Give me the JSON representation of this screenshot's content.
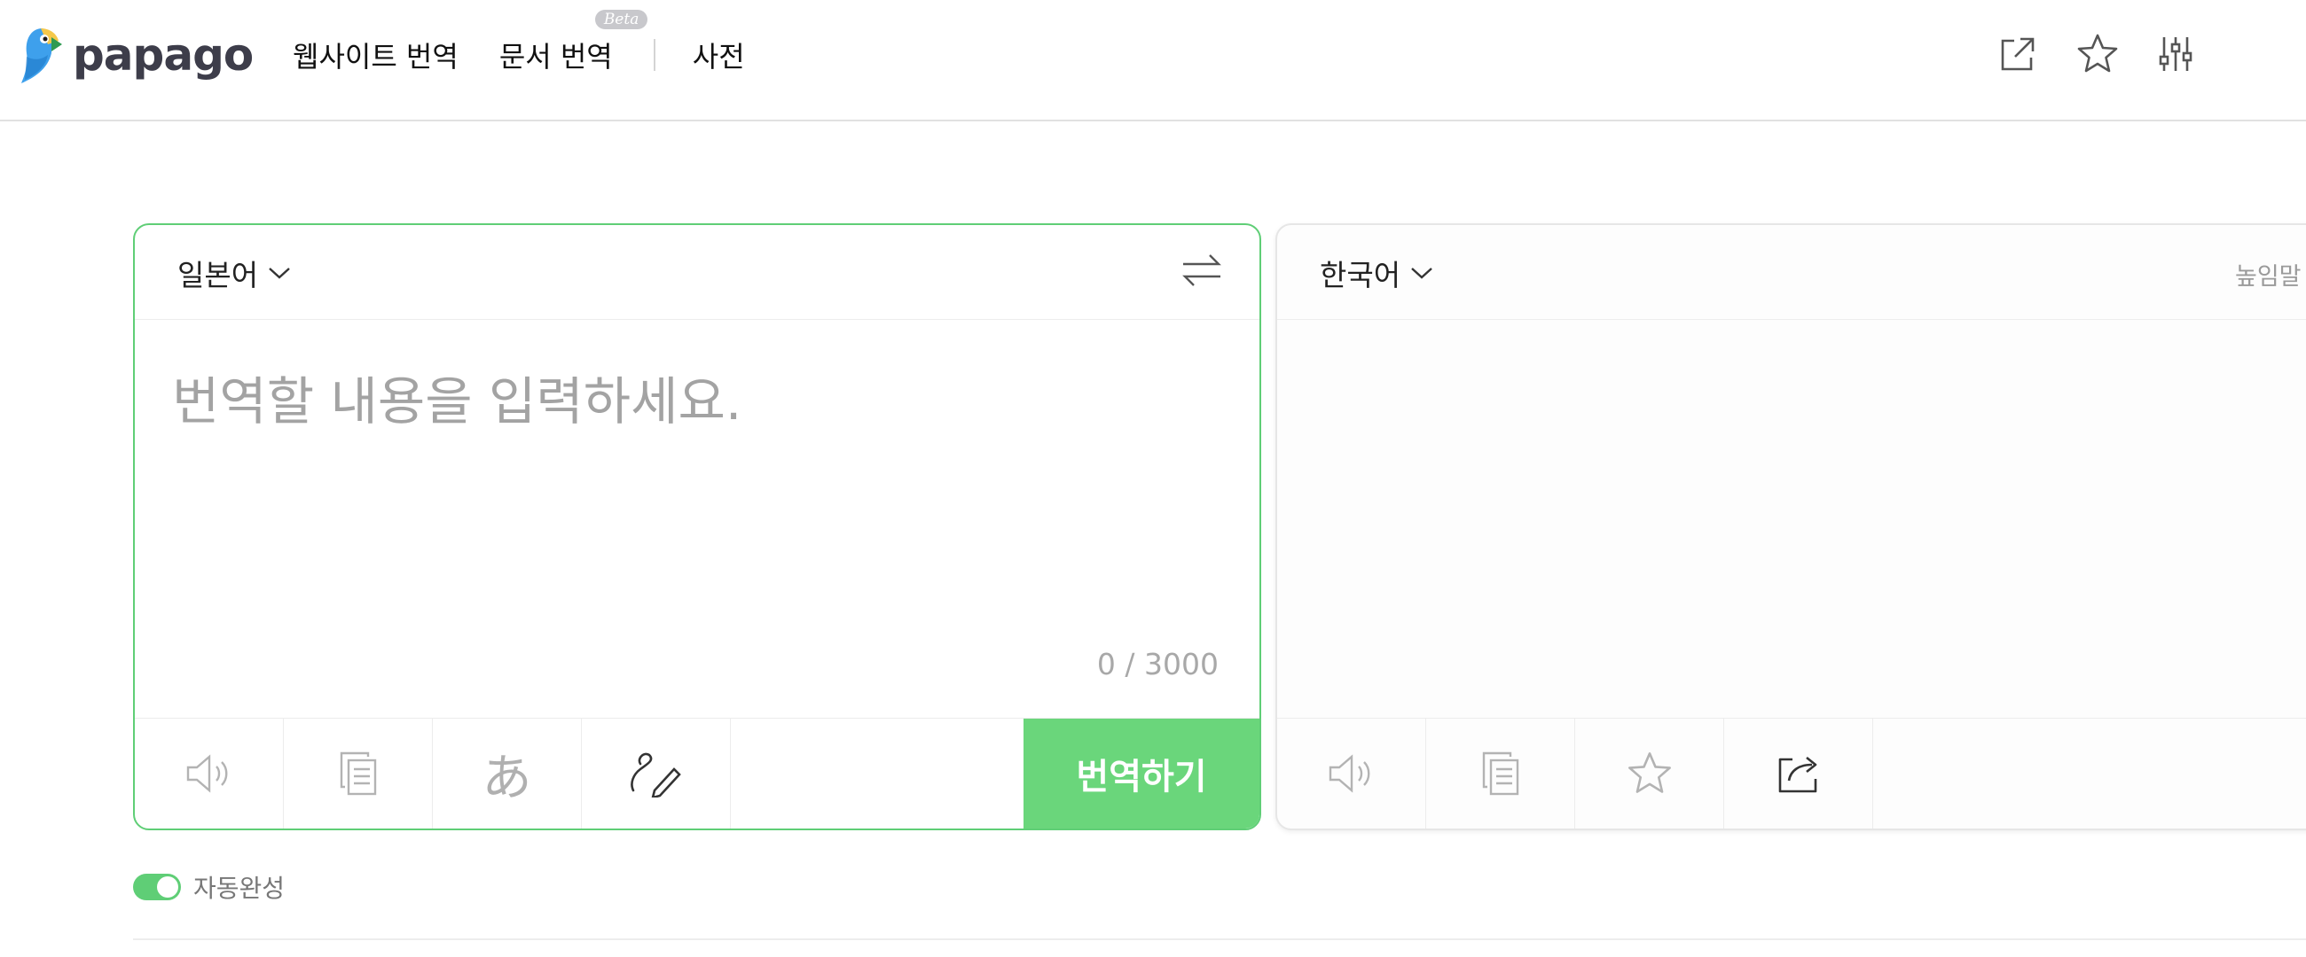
{
  "app": {
    "logo_text": "papago"
  },
  "nav": {
    "website_translation": "웹사이트 번역",
    "document_translation": "문서 번역",
    "beta_badge": "Beta",
    "dictionary": "사전"
  },
  "header_icons": [
    "external-link-icon",
    "star-icon",
    "settings-sliders-icon"
  ],
  "source": {
    "language": "일본어",
    "placeholder": "번역할 내용을 입력하세요.",
    "counter": "0 / 3000",
    "tools": [
      "speaker-icon",
      "copy-icon",
      "japanese-a-character-icon",
      "handwriting-pen-icon"
    ],
    "translate_button": "번역하기"
  },
  "target": {
    "language": "한국어",
    "honorific_label": "높임말",
    "tools": [
      "speaker-icon",
      "copy-icon",
      "star-icon",
      "share-icon"
    ]
  },
  "autocomplete": {
    "label": "자동완성",
    "enabled": true
  },
  "colors": {
    "accent": "#5fce76",
    "translate_button": "#6ad67b",
    "header_border": "#e1e1e1"
  }
}
